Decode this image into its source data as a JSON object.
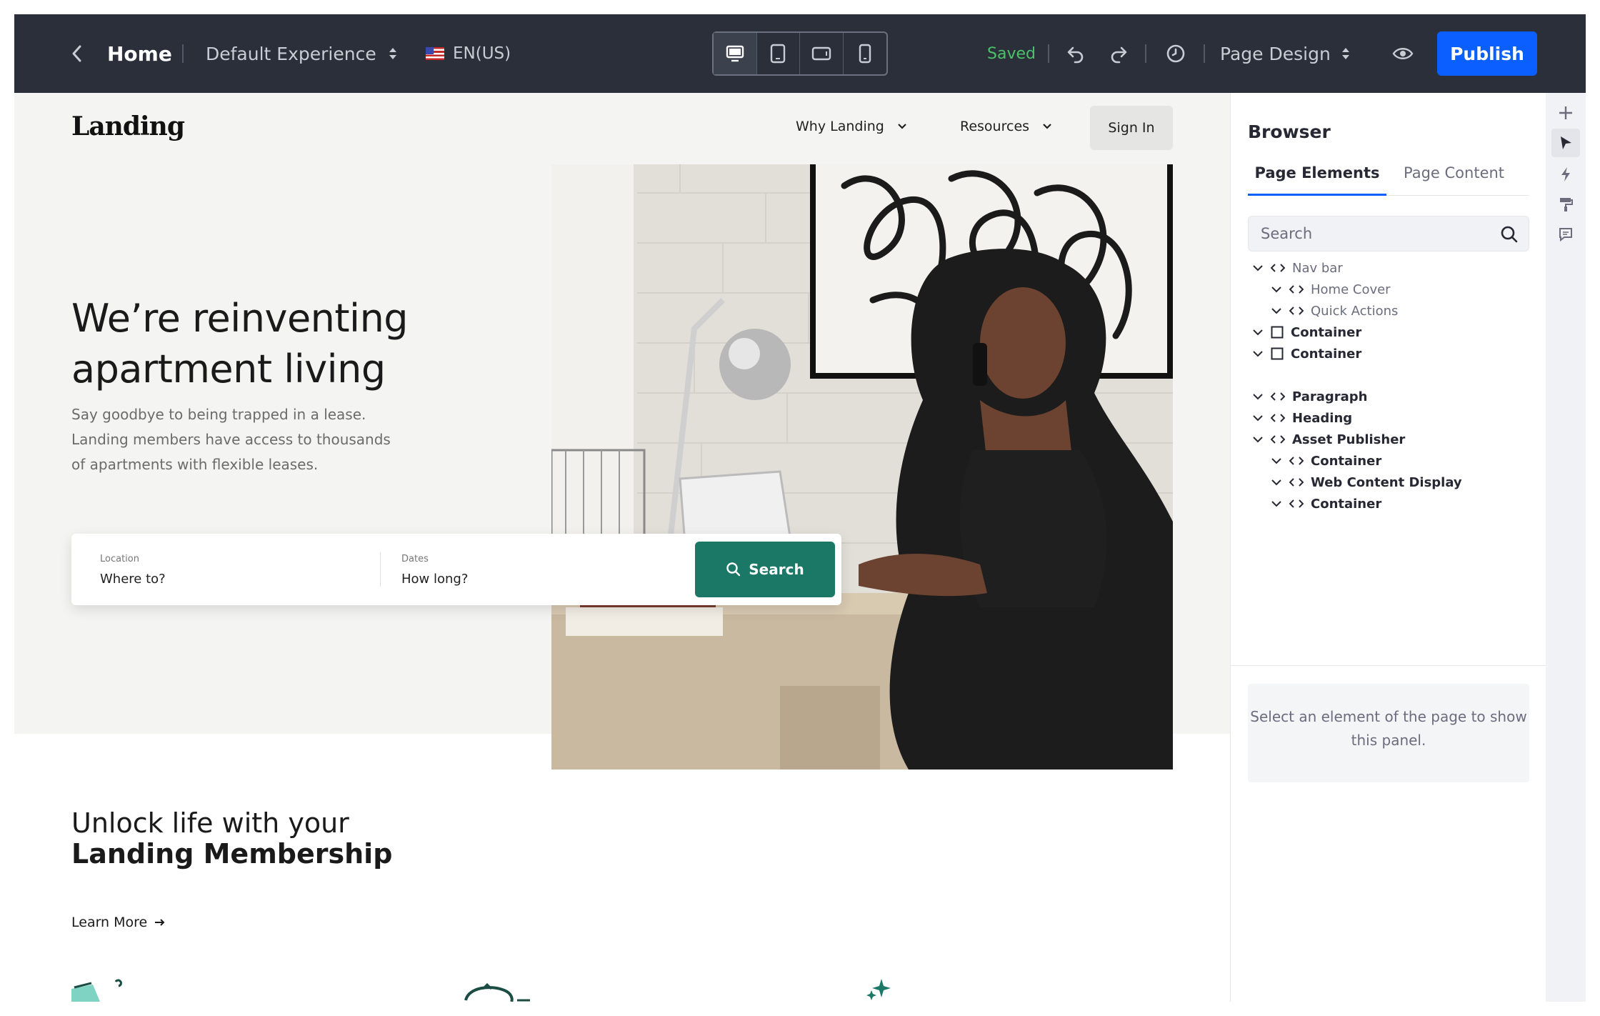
{
  "toolbar": {
    "title": "Home",
    "experience": "Default Experience",
    "language": "EN(US)",
    "status": "Saved",
    "page_design": "Page Design",
    "publish_label": "Publish",
    "devices": [
      "desktop",
      "tablet",
      "tablet-landscape",
      "mobile"
    ]
  },
  "site": {
    "logo": "Landing",
    "nav": [
      "Why Landing",
      "Resources"
    ],
    "signin": "Sign In",
    "hero_title": "We’re reinventing apartment living",
    "hero_text": "Say goodbye to being trapped in a lease. Landing members have access to thousands of apartments with flexible leases.",
    "search": {
      "location_label": "Location",
      "location_value": "Where to?",
      "dates_label": "Dates",
      "dates_value": "How long?",
      "button": "Search"
    },
    "unlock_line1": "Unlock life with your",
    "unlock_line2": "Landing Membership",
    "learn_more": "Learn More"
  },
  "panel": {
    "title": "Browser",
    "tabs": [
      "Page Elements",
      "Page Content"
    ],
    "search_placeholder": "Search",
    "tree": [
      {
        "label": "Nav bar",
        "level": 0,
        "icon": "code-icon",
        "dim": true
      },
      {
        "label": "Home Cover",
        "level": 1,
        "icon": "code-icon",
        "dim": true
      },
      {
        "label": "Quick Actions",
        "level": 1,
        "icon": "code-icon",
        "dim": true
      },
      {
        "label": "Container",
        "level": 0,
        "icon": "box-icon",
        "dim": false
      },
      {
        "label": "Container",
        "level": 0,
        "icon": "box-icon",
        "dim": false
      },
      {
        "label": "Paragraph",
        "level": 0,
        "icon": "code-icon",
        "dim": false
      },
      {
        "label": "Heading",
        "level": 0,
        "icon": "code-icon",
        "dim": false
      },
      {
        "label": "Asset Publisher",
        "level": 0,
        "icon": "code-icon",
        "dim": false
      },
      {
        "label": "Container",
        "level": 1,
        "icon": "code-icon",
        "dim": false
      },
      {
        "label": "Web Content Display",
        "level": 1,
        "icon": "code-icon",
        "dim": false
      },
      {
        "label": "Container",
        "level": 1,
        "icon": "code-icon",
        "dim": false
      }
    ],
    "empty_message": "Select an element of the page to show this panel."
  },
  "rail": [
    "plus-icon",
    "cursor-icon",
    "lightning-icon",
    "paint-roller-icon",
    "comment-icon"
  ],
  "colors": {
    "topbar": "#2b2f3a",
    "publish": "#0b5fff",
    "saved": "#4cc16a",
    "search_button": "#1b7766"
  }
}
